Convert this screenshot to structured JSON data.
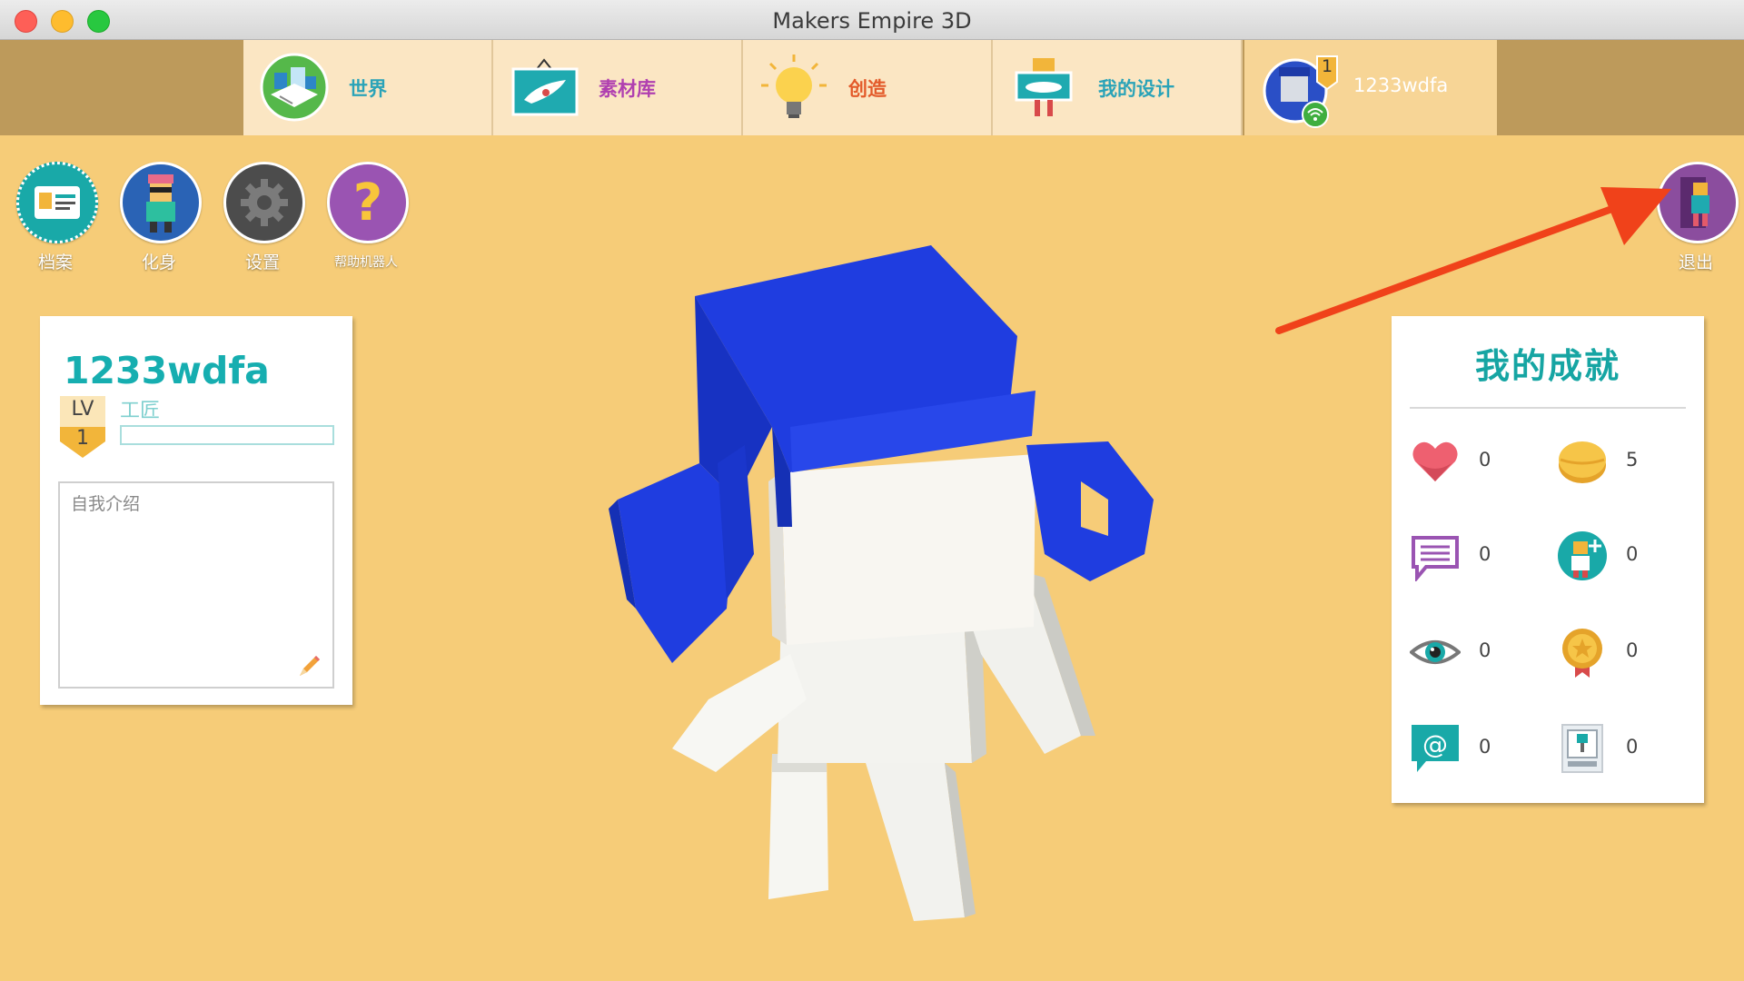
{
  "window": {
    "title": "Makers Empire 3D"
  },
  "nav": {
    "tabs": [
      {
        "label": "世界",
        "color": "#2aa3b8",
        "icon": "world-icon"
      },
      {
        "label": "素材库",
        "color": "#b040b0",
        "icon": "library-icon"
      },
      {
        "label": "创造",
        "color": "#e35a2a",
        "icon": "lightbulb-icon"
      },
      {
        "label": "我的设计",
        "color": "#2aa3b8",
        "icon": "my-designs-icon"
      }
    ],
    "profile": {
      "username": "1233wdfa",
      "badge_level": "1"
    }
  },
  "sidebar": {
    "buttons": [
      {
        "label": "档案",
        "icon": "profile-card-icon"
      },
      {
        "label": "化身",
        "icon": "avatar-icon"
      },
      {
        "label": "设置",
        "icon": "gear-icon"
      },
      {
        "label": "帮助机器人",
        "icon": "help-icon"
      }
    ],
    "logout": {
      "label": "退出",
      "icon": "logout-door-icon"
    }
  },
  "profile_card": {
    "username": "1233wdfa",
    "level_label": "LV",
    "level_number": "1",
    "rank": "工匠",
    "xp_progress": 0,
    "bio_placeholder": "自我介绍"
  },
  "achievements": {
    "title": "我的成就",
    "stats": [
      {
        "icon": "heart-icon",
        "value": "0"
      },
      {
        "icon": "coin-icon",
        "value": "5"
      },
      {
        "icon": "comment-icon",
        "value": "0"
      },
      {
        "icon": "follower-add-icon",
        "value": "0"
      },
      {
        "icon": "eye-icon",
        "value": "0"
      },
      {
        "icon": "medal-icon",
        "value": "0"
      },
      {
        "icon": "mention-icon",
        "value": "0"
      },
      {
        "icon": "printer-icon",
        "value": "0"
      }
    ]
  },
  "colors": {
    "accent_teal": "#16aeb0",
    "background": "#f6cc78",
    "avatar_hair": "#1f3de0"
  }
}
